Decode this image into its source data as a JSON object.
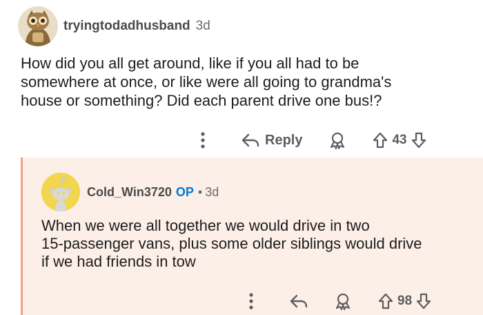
{
  "comment": {
    "username": "tryingtodadhusband",
    "age": "3d",
    "body_lines": [
      "How did you all get around, like if you all had to be",
      "somewhere at once, or like were all going to grandma's",
      "house or something? Did each parent drive one bus!?"
    ],
    "actions": {
      "reply_label": "Reply",
      "score": "43"
    }
  },
  "reply": {
    "username": "Cold_Win3720",
    "op_label": "OP",
    "separator": "•",
    "age": "3d",
    "body_lines": [
      "When we were all together we would drive in two",
      "15-passenger vans, plus some older siblings would drive",
      "if we had friends in tow"
    ],
    "actions": {
      "score": "98"
    }
  },
  "colors": {
    "op_accent": "#0079d3",
    "reply_background": "#fcefe8",
    "thread_line": "#f0a088",
    "snoo_avatar_bg": "#f2d64d"
  },
  "icons": {
    "more": "vertical-ellipsis-icon",
    "reply": "reply-arrow-icon",
    "award": "award-icon",
    "upvote": "upvote-arrow-icon",
    "downvote": "downvote-arrow-icon"
  }
}
